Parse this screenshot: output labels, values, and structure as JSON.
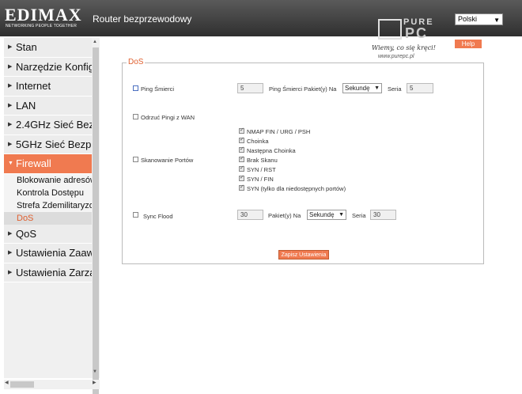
{
  "header": {
    "logo": "EDIMAX",
    "logo_tagline": "NETWORKING PEOPLE TOGETHER",
    "title": "Router bezprzewodowy",
    "language": "Polski",
    "help": "Help"
  },
  "watermark": {
    "brand_top": "PURE",
    "brand_bottom": "PC",
    "slogan": "Wiemy, co się kręci!",
    "url": "www.purepc.pl"
  },
  "sidebar": {
    "items": [
      {
        "label": "Stan"
      },
      {
        "label": "Narzędzie Konfigu"
      },
      {
        "label": "Internet"
      },
      {
        "label": "LAN"
      },
      {
        "label": "2.4GHz Sieć Bez"
      },
      {
        "label": "5GHz Sieć Bezpr"
      },
      {
        "label": "Firewall"
      },
      {
        "label": "QoS"
      },
      {
        "label": "Ustawienia Zaaw"
      },
      {
        "label": "Ustawienia Zarzą"
      }
    ],
    "firewall_sub": [
      {
        "label": "Blokowanie adresów"
      },
      {
        "label": "Kontrola Dostępu"
      },
      {
        "label": "Strefa Zdemilitaryzov"
      },
      {
        "label": "DoS"
      }
    ]
  },
  "dos": {
    "legend": "DoS",
    "ping_of_death": {
      "label": "Ping Śmierci",
      "count": "5",
      "per_label": "Ping Śmierci Pakiet(y) Na",
      "unit": "Sekundę",
      "burst_label": "Seria",
      "burst": "5"
    },
    "discard_ping": {
      "label": "Odrzuć Pingi z WAN"
    },
    "port_scan": {
      "label": "Skanowanie Portów",
      "options": [
        {
          "label": "NMAP FIN / URG / PSH"
        },
        {
          "label": "Choinka"
        },
        {
          "label": "Następna Choinka"
        },
        {
          "label": "Brak Skanu"
        },
        {
          "label": "SYN / RST"
        },
        {
          "label": "SYN / FIN"
        },
        {
          "label": "SYN (tylko dla niedostępnych portów)"
        }
      ]
    },
    "sync_flood": {
      "label": "Sync Flood",
      "count": "30",
      "per_label": "Pakiet(y) Na",
      "unit": "Sekundę",
      "burst_label": "Seria",
      "burst": "30"
    },
    "save": "Zapisz Ustawienia"
  },
  "colors": {
    "accent": "#f07a50",
    "header": "#3a3a3a",
    "sidebar": "#ececec"
  }
}
